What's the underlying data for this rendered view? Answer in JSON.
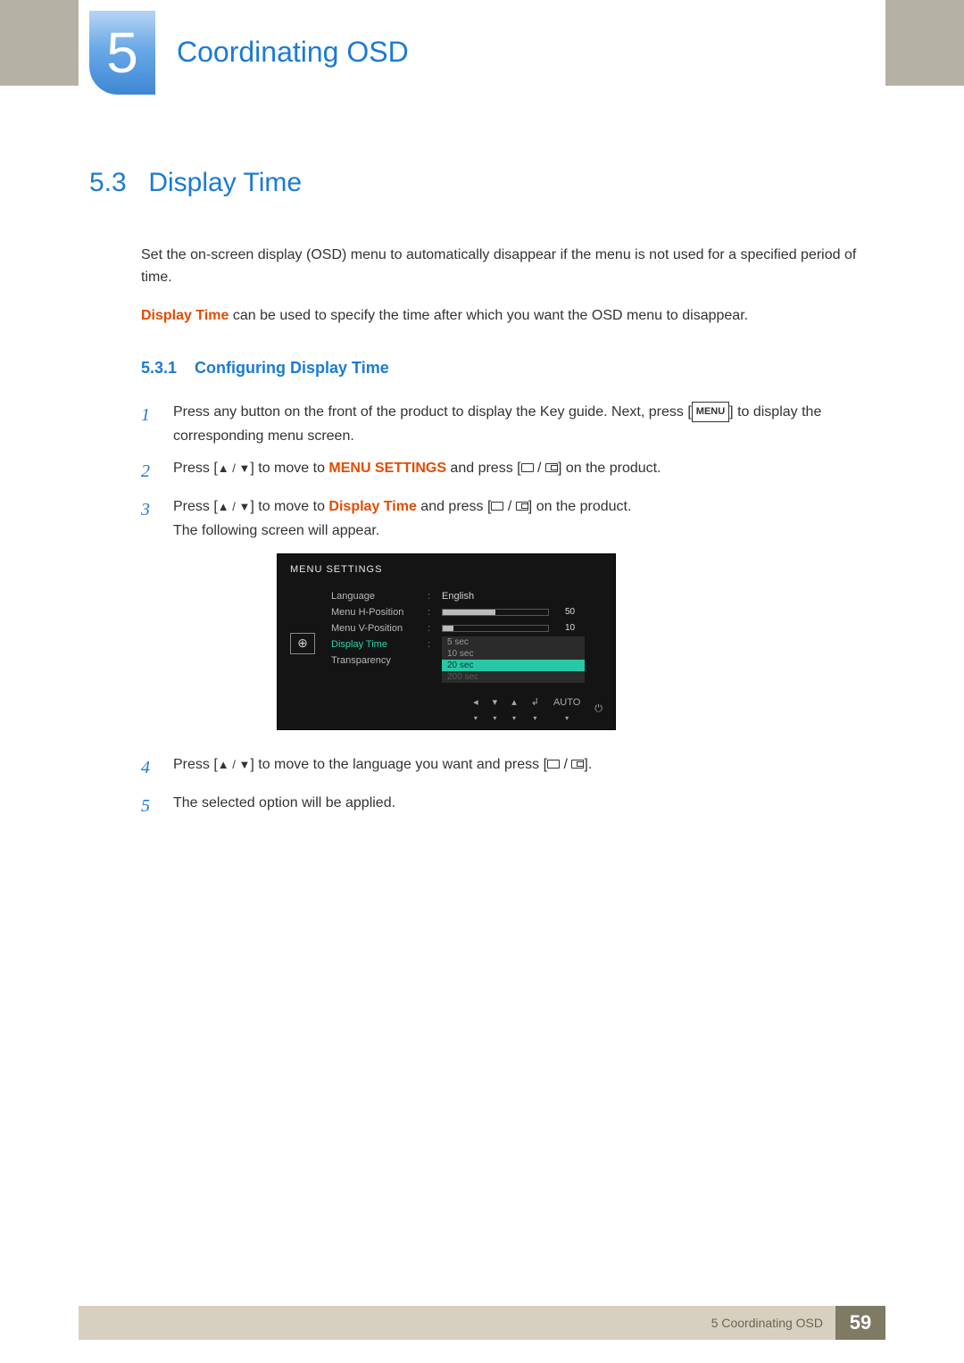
{
  "chapter": {
    "number": "5",
    "title": "Coordinating OSD"
  },
  "section": {
    "number": "5.3",
    "title": "Display Time"
  },
  "intro_p1": "Set the on-screen display (OSD) menu to automatically disappear if the menu is not used for a specified period of time.",
  "intro_p2_term": "Display Time",
  "intro_p2_rest": " can be used to specify the time after which you want the OSD menu to disappear.",
  "subsection": {
    "number": "5.3.1",
    "title": "Configuring Display Time"
  },
  "steps": {
    "s1a": "Press any button on the front of the product to display the Key guide. Next, press [",
    "s1_menu": "MENU",
    "s1b": "] to display the corresponding menu screen.",
    "s2a": "Press [",
    "s2b": "] to move to ",
    "s2_target": "MENU SETTINGS",
    "s2c": " and press [",
    "s2d": "] on the product.",
    "s3a": "Press [",
    "s3b": "] to move to ",
    "s3_target": "Display Time",
    "s3c": " and press [",
    "s3d": "] on the product.",
    "s3e": "The following screen will appear.",
    "s4a": "Press [",
    "s4b": "] to move to the language you want and press [",
    "s4c": "].",
    "s5": "The selected option will be applied."
  },
  "osd": {
    "title": "MENU SETTINGS",
    "rows": {
      "language": {
        "label": "Language",
        "value": "English"
      },
      "hpos": {
        "label": "Menu H-Position",
        "value": "50",
        "fill_pct": 50
      },
      "vpos": {
        "label": "Menu V-Position",
        "value": "10",
        "fill_pct": 10
      },
      "dtime": {
        "label": "Display Time"
      },
      "trans": {
        "label": "Transparency"
      }
    },
    "options": [
      "5 sec",
      "10 sec",
      "20 sec",
      "200 sec"
    ],
    "selected_option_index": 2,
    "footer": {
      "auto": "AUTO"
    }
  },
  "footer": {
    "text": "5 Coordinating OSD",
    "page": "59"
  }
}
